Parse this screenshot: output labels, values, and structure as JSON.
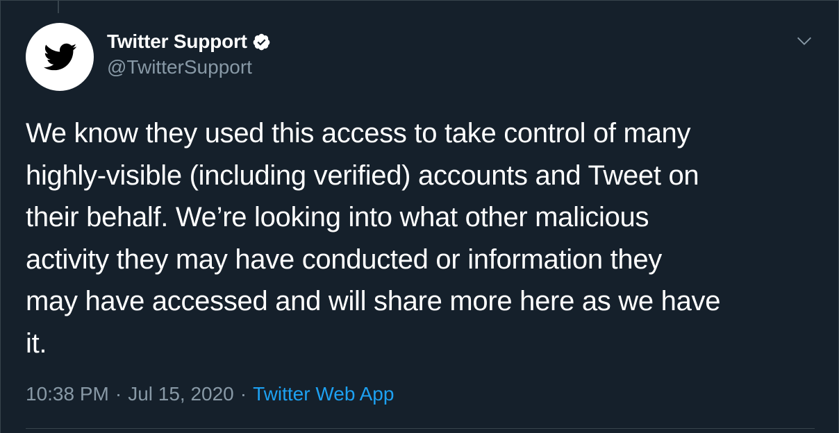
{
  "tweet": {
    "author": {
      "display_name": "Twitter Support",
      "handle": "@TwitterSupport",
      "verified": true,
      "avatar_icon": "twitter-bird-icon"
    },
    "text": "We know they used this access to take control of many\nhighly-visible (including verified) accounts and Tweet on\ntheir behalf. We’re looking into what other malicious\nactivity they may have conducted or information they\nmay have accessed and will share more here as we have\nit.",
    "time": "10:38 PM",
    "date": "Jul 15, 2020",
    "separator": "·",
    "source": "Twitter Web App"
  },
  "colors": {
    "background": "#15202b",
    "secondary_text": "#8899a6",
    "accent": "#1da1f2",
    "divider": "#38444d"
  }
}
